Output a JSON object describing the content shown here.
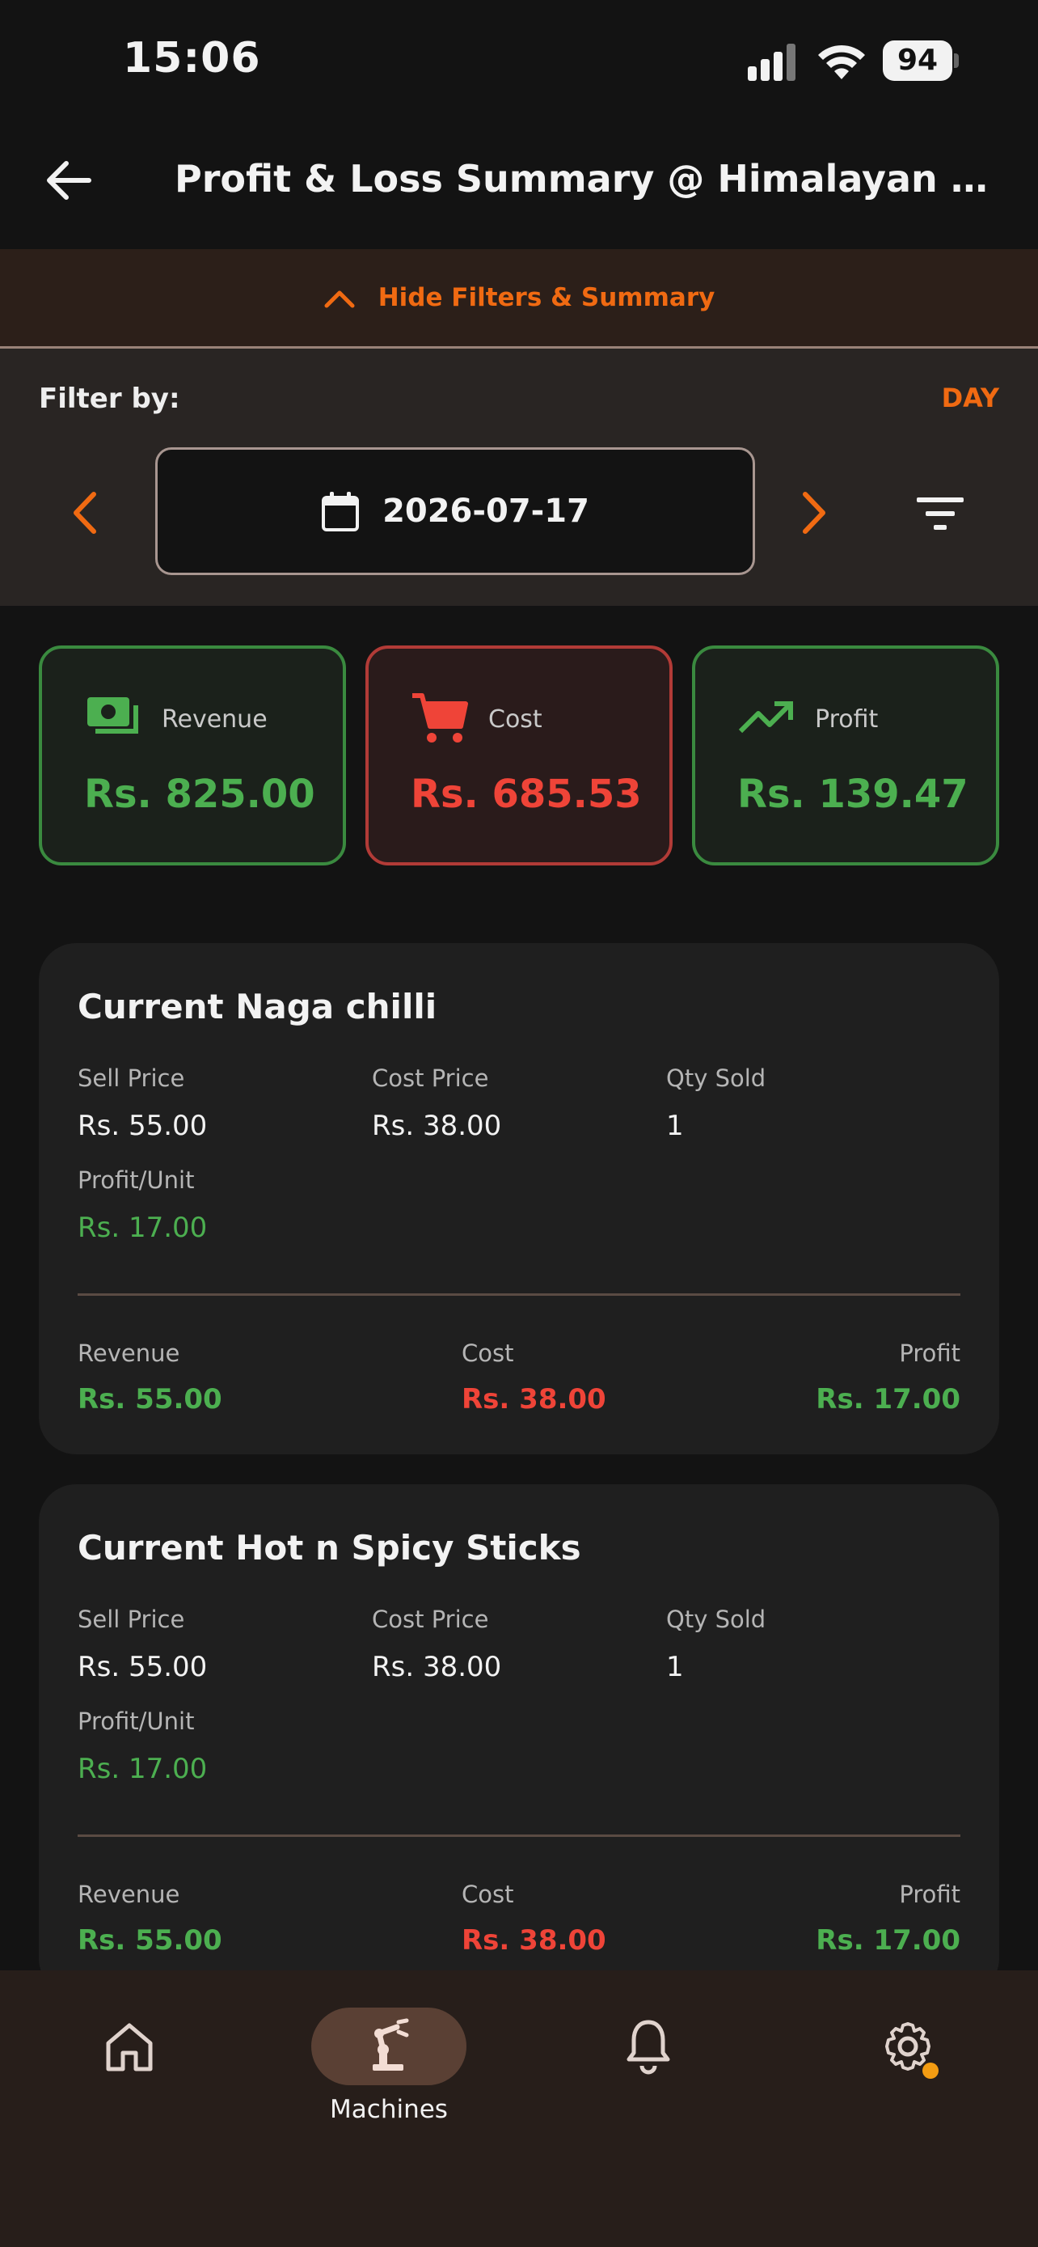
{
  "status_bar": {
    "time": "15:06",
    "battery": "94"
  },
  "header": {
    "title": "Profit & Loss Summary @ Himalayan White ..."
  },
  "filter_toggle": {
    "label": "Hide Filters & Summary"
  },
  "filters": {
    "label": "Filter by:",
    "period": "DAY",
    "date": "2026-07-17"
  },
  "summary": {
    "revenue": {
      "label": "Revenue",
      "value": "Rs. 825.00"
    },
    "cost": {
      "label": "Cost",
      "value": "Rs. 685.53"
    },
    "profit": {
      "label": "Profit",
      "value": "Rs. 139.47"
    }
  },
  "products": [
    {
      "name": "Current Naga chilli",
      "sell_price_label": "Sell Price",
      "sell_price": "Rs. 55.00",
      "cost_price_label": "Cost Price",
      "cost_price": "Rs. 38.00",
      "qty_label": "Qty Sold",
      "qty": "1",
      "profit_unit_label": "Profit/Unit",
      "profit_unit": "Rs. 17.00",
      "revenue_label": "Revenue",
      "revenue": "Rs. 55.00",
      "cost_label": "Cost",
      "cost": "Rs. 38.00",
      "profit_label": "Profit",
      "profit": "Rs. 17.00"
    },
    {
      "name": "Current Hot n Spicy Sticks",
      "sell_price_label": "Sell Price",
      "sell_price": "Rs. 55.00",
      "cost_price_label": "Cost Price",
      "cost_price": "Rs. 38.00",
      "qty_label": "Qty Sold",
      "qty": "1",
      "profit_unit_label": "Profit/Unit",
      "profit_unit": "Rs. 17.00",
      "revenue_label": "Revenue",
      "revenue": "Rs. 55.00",
      "cost_label": "Cost",
      "cost": "Rs. 38.00",
      "profit_label": "Profit",
      "profit": "Rs. 17.00"
    }
  ],
  "bottom_nav": {
    "items": [
      {
        "icon": "home-icon",
        "label": ""
      },
      {
        "icon": "robot-arm-icon",
        "label": "Machines",
        "active": true
      },
      {
        "icon": "bell-icon",
        "label": ""
      },
      {
        "icon": "gear-icon",
        "label": "",
        "badge": true
      }
    ]
  },
  "colors": {
    "accent": "#f06a12",
    "positive": "#4caf50",
    "negative": "#ef4438",
    "background": "#131313"
  }
}
